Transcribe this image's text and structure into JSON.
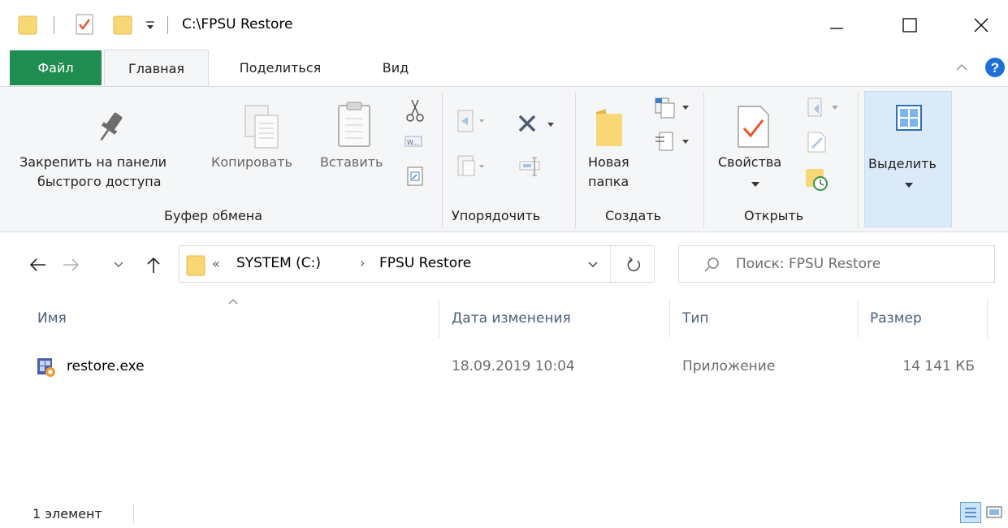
{
  "window": {
    "title": "C:\\FPSU Restore"
  },
  "tabs": [
    {
      "label": "Файл"
    },
    {
      "label": "Главная"
    },
    {
      "label": "Поделиться"
    },
    {
      "label": "Вид"
    }
  ],
  "ribbon": {
    "clipboard": {
      "pin_line1": "Закрепить на панели",
      "pin_line2": "быстрого доступа",
      "copy": "Копировать",
      "paste": "Вставить",
      "group": "Буфер обмена"
    },
    "organize": {
      "group": "Упорядочить"
    },
    "create": {
      "new_folder_line1": "Новая",
      "new_folder_line2": "папка",
      "group": "Создать"
    },
    "open": {
      "properties": "Свойства",
      "group": "Открыть"
    },
    "select": {
      "label": "Выделить"
    }
  },
  "address": {
    "overflow": "«",
    "crumbs": [
      "SYSTEM (C:)",
      "FPSU Restore"
    ],
    "separator": "›"
  },
  "search": {
    "placeholder": "Поиск: FPSU Restore"
  },
  "columns": [
    "Имя",
    "Дата изменения",
    "Тип",
    "Размер"
  ],
  "files": [
    {
      "name": "restore.exe",
      "modified": "18.09.2019 10:04",
      "type": "Приложение",
      "size": "14 141 КБ"
    }
  ],
  "status": {
    "count": "1 элемент"
  },
  "colors": {
    "file_tab": "#1e8d4f",
    "ribbon_bg": "#f5f6f7",
    "selected_bg": "#dbeaf8",
    "folder": "#f8d775",
    "help": "#1c70d5"
  }
}
